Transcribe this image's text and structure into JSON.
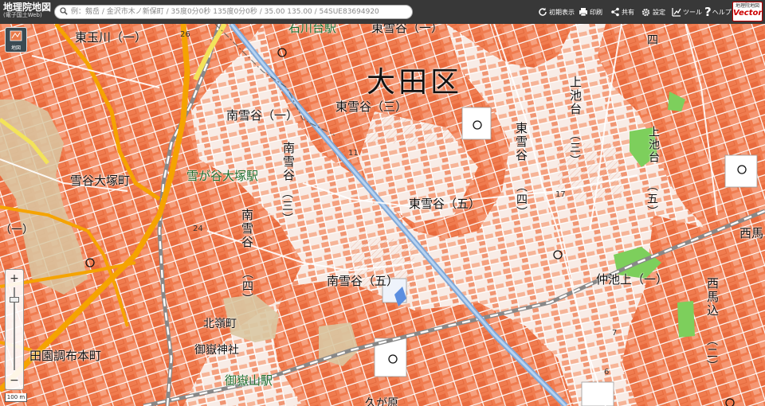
{
  "header": {
    "logo_title": "地理院地図",
    "logo_subtitle": "(電子国土Web)",
    "search_placeholder": "例：剱岳 / 金沢市木ノ新保町 / 35度0分0秒 135度0分0秒 / 35.00 135.00 / 54SUE83694920",
    "buttons": {
      "reset_view": "初期表示",
      "print": "印刷",
      "share": "共有",
      "settings": "設定",
      "tools": "ツール",
      "help": "ヘルプ"
    },
    "badge_top": "地理院地図",
    "badge_bottom": "Vector"
  },
  "map_controls": {
    "layer_button_label": "地図",
    "zoom_in": "+",
    "zoom_out": "−",
    "scale": "100 m"
  },
  "map_labels": {
    "ward": "大田区",
    "higashi_tamagawa_1": "東玉川（一）",
    "ishikawadai_station": "石川台駅",
    "higashi_yukigaya_1": "東雪谷（一）",
    "minami_yukigaya_1": "南雪谷（一）",
    "higashi_yukigaya_3": "東雪谷（三）",
    "minami_yukigaya_3": "南雪谷",
    "minami_yukigaya_3_num": "（三）",
    "yukigaya_otsuka_machi": "雪谷大塚町",
    "yukigaya_otsuka_station": "雪が谷大塚駅",
    "higashi_yukigaya_5": "東雪谷（五）",
    "higashi_yukigaya_4": "東雪谷",
    "higashi_yukigaya_4_num": "（四）",
    "kamiikedai_3": "上池台",
    "kamiikedai_3_num": "（三）",
    "kamiikedai_green": "上池台",
    "kamiikedai_5_num": "（五）",
    "minami_yukigaya_4": "南雪谷",
    "minami_yukigaya_4_num": "（四）",
    "minami_yukigaya_5": "南雪谷（五）",
    "kitaminecho": "北嶺町",
    "ontake_shrine": "御嶽神社",
    "ontakesan_station": "御嶽山駅",
    "denenchofu_honmachi": "田園調布本町",
    "kugahara": "久が原",
    "nakaikegami_1": "仲池上（一）",
    "nishi_magome_2": "西馬込",
    "nishi_magome_2_num": "（二）",
    "nishi_magome_edge": "西馬",
    "yon_top": "四",
    "ichi_left": "（一）",
    "el_26": "26",
    "el_11": "11",
    "el_17": "17",
    "el_24": "24",
    "el_7": "7",
    "el_6": "6"
  },
  "colors": {
    "residential": "#f07c4f",
    "residential_line": "#d95b2e",
    "park": "#7dcf5c",
    "highway": "#f5a300",
    "railway_line": "#8fb6e6",
    "lowland": "#d9c8a3",
    "topbar": "#383838"
  },
  "icons": [
    "search-icon",
    "reset-view-icon",
    "print-icon",
    "share-icon",
    "settings-icon",
    "tools-icon",
    "help-icon",
    "layers-icon"
  ]
}
